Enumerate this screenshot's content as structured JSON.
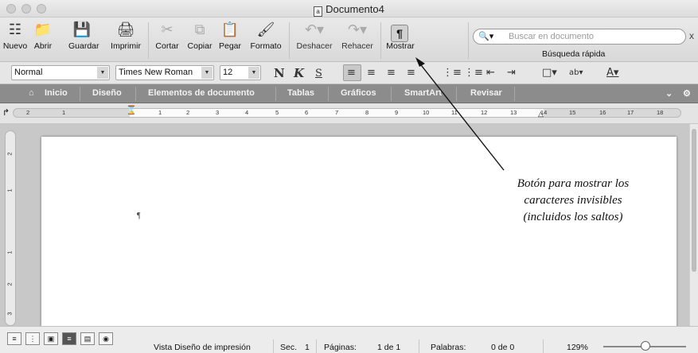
{
  "window": {
    "title": "Documento4"
  },
  "toolbar": {
    "buttons": [
      {
        "label": "Nuevo",
        "icon": "new-document-icon"
      },
      {
        "label": "Abrir",
        "icon": "open-folder-icon"
      },
      {
        "label": "Guardar",
        "icon": "save-icon"
      },
      {
        "label": "Imprimir",
        "icon": "print-icon"
      },
      {
        "label": "Cortar",
        "icon": "scissors-icon"
      },
      {
        "label": "Copiar",
        "icon": "copy-icon"
      },
      {
        "label": "Pegar",
        "icon": "paste-icon"
      },
      {
        "label": "Formato",
        "icon": "format-painter-icon"
      },
      {
        "label": "Deshacer",
        "icon": "undo-icon"
      },
      {
        "label": "Rehacer",
        "icon": "redo-icon"
      },
      {
        "label": "Mostrar",
        "icon": "pilcrow-icon"
      }
    ],
    "search_placeholder": "Buscar en documento",
    "search_label": "Búsqueda rápida"
  },
  "format": {
    "style": "Normal",
    "font": "Times New Roman",
    "size": "12",
    "bold": "N",
    "italic": "K",
    "underline": "S"
  },
  "ribbon": {
    "tabs": [
      "Inicio",
      "Diseño",
      "Elementos de documento",
      "Tablas",
      "Gráficos",
      "SmartArt",
      "Revisar"
    ]
  },
  "ruler": {
    "labels": [
      "2",
      "1",
      "1",
      "2",
      "3",
      "4",
      "5",
      "6",
      "7",
      "8",
      "9",
      "10",
      "11",
      "12",
      "13",
      "14",
      "15",
      "16",
      "17",
      "18"
    ]
  },
  "vruler": {
    "labels": [
      "2",
      "1",
      "1",
      "2",
      "3"
    ]
  },
  "document": {
    "pilcrow": "¶"
  },
  "statusbar": {
    "view": "Vista Diseño de impresión",
    "sec_label": "Sec.",
    "sec_value": "1",
    "pages_label": "Páginas:",
    "pages_value": "1 de 1",
    "words_label": "Palabras:",
    "words_value": "0 de 0",
    "zoom": "129%"
  },
  "annotation": {
    "lines": [
      "Botón para mostrar los",
      "caracteres invisibles",
      "(incluidos los saltos)"
    ]
  },
  "colors": {
    "annotation_arrow": "#111111",
    "tab_bar": "#8c8c8c"
  }
}
